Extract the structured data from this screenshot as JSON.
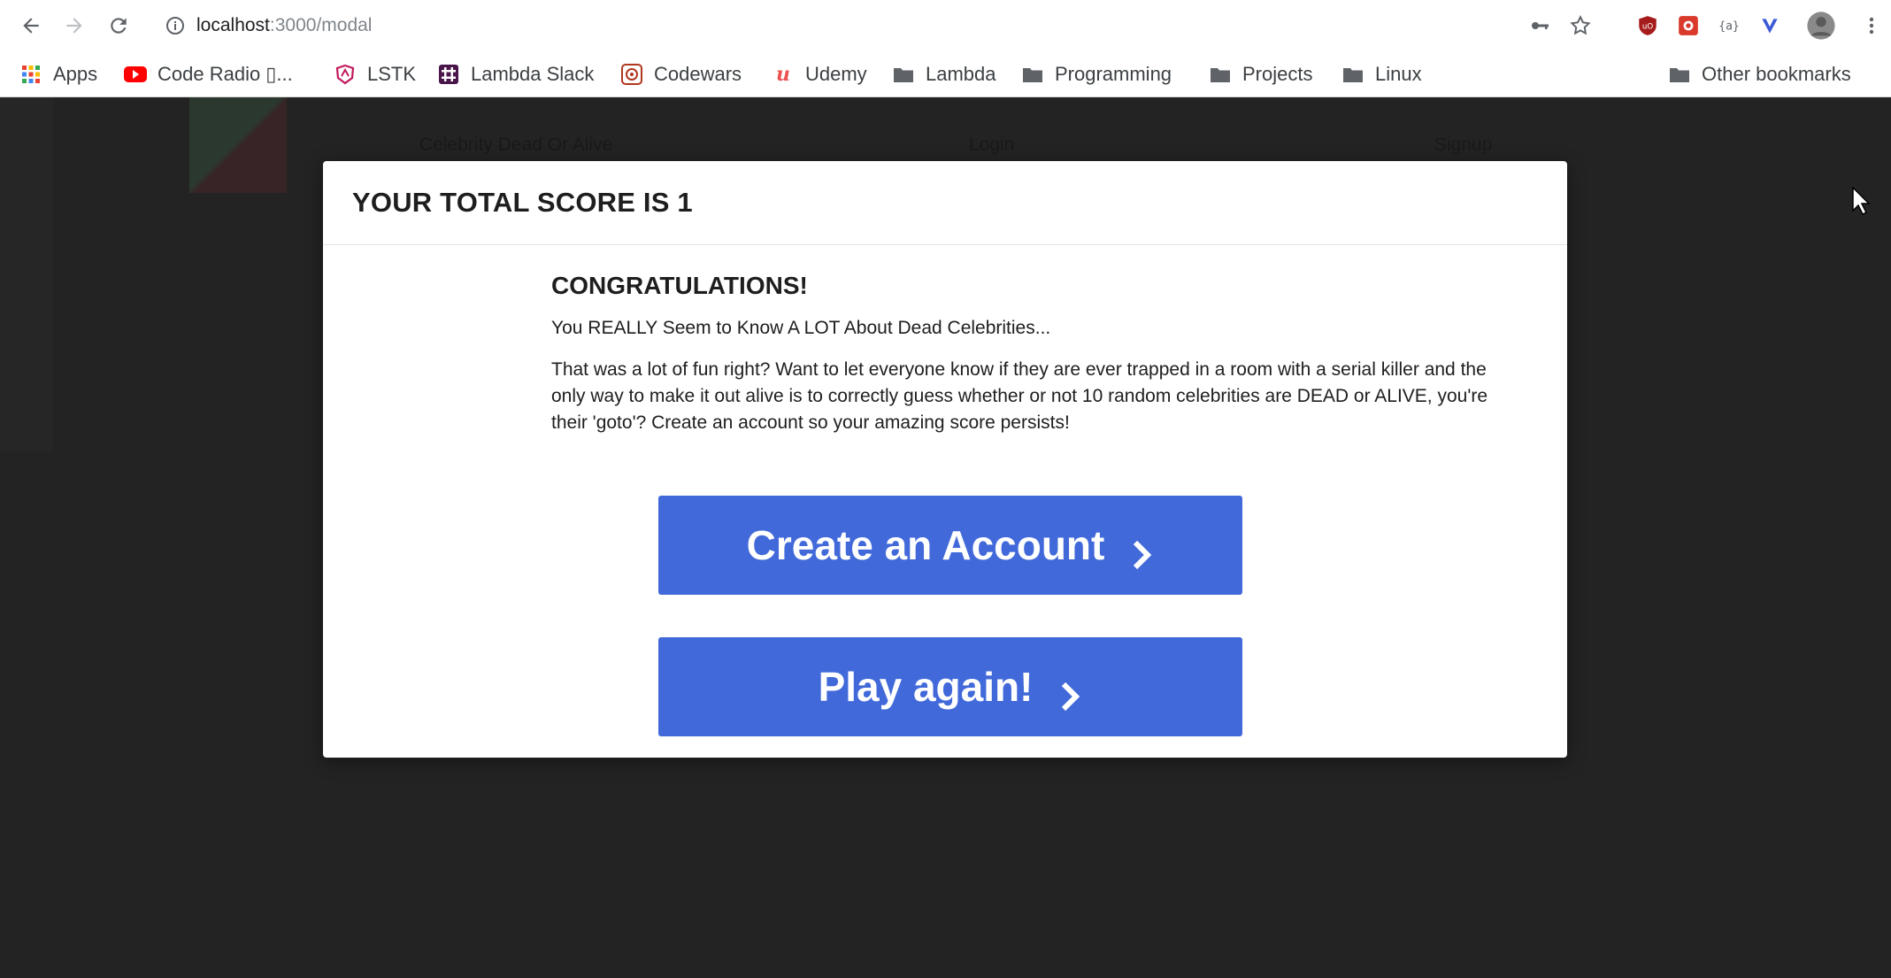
{
  "browser": {
    "url_host": "localhost",
    "url_path": ":3000/modal",
    "bookmarks": [
      {
        "label": "Apps",
        "icon": "apps-grid-icon"
      },
      {
        "label": "Code Radio ▯...",
        "icon": "youtube-icon"
      },
      {
        "label": "LSTK",
        "icon": "lstk-shield-icon"
      },
      {
        "label": "Lambda Slack",
        "icon": "slack-icon"
      },
      {
        "label": "Codewars",
        "icon": "codewars-icon"
      },
      {
        "label": "Udemy",
        "icon": "udemy-icon"
      },
      {
        "label": "Lambda",
        "icon": "folder-icon"
      },
      {
        "label": "Programming",
        "icon": "folder-icon"
      },
      {
        "label": "Projects",
        "icon": "folder-icon"
      },
      {
        "label": "Linux",
        "icon": "folder-icon"
      }
    ],
    "other_bookmarks": "Other bookmarks"
  },
  "page": {
    "nav": {
      "brand": "Celebrity Dead Or Alive",
      "login": "Login",
      "signup": "Signup"
    }
  },
  "modal": {
    "title": "YOUR TOTAL SCORE IS 1",
    "congrats": "CONGRATULATIONS!",
    "tagline": "You REALLY Seem to Know A LOT About Dead Celebrities...",
    "pitch": "That was a lot of fun right? Want to let everyone know if they are ever trapped in a room with a serial killer and the only way to make it out alive is to correctly guess whether or not 10 random celebrities are DEAD or ALIVE, you're their 'goto'? Create an account so your amazing score persists!",
    "create_label": "Create an Account",
    "play_label": "Play again!"
  },
  "colors": {
    "button": "#4169d9",
    "backdrop": "#232323"
  }
}
